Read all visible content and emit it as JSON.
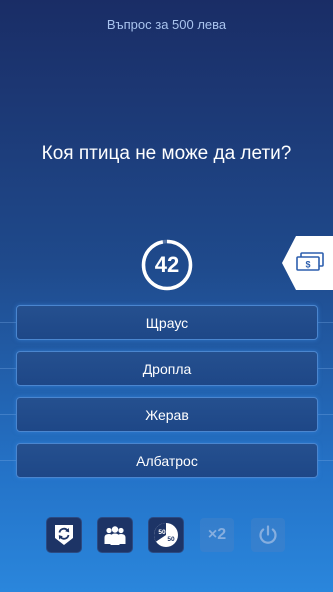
{
  "header": {
    "prize_label": "Въпрос за 500 лева"
  },
  "question": {
    "text": "Коя птица не може да лети?"
  },
  "timer": {
    "seconds": 42,
    "display": "42"
  },
  "answers": [
    {
      "label": "Щраус"
    },
    {
      "label": "Дропла"
    },
    {
      "label": "Жерав"
    },
    {
      "label": "Албатрос"
    }
  ],
  "lifelines": {
    "switch_question": {
      "icon": "switch-question-icon",
      "state": "available"
    },
    "ask_audience": {
      "icon": "audience-icon",
      "state": "available"
    },
    "fifty_fifty": {
      "icon": "fifty-fifty-icon",
      "label_a": "50",
      "label_b": "50",
      "state": "available"
    },
    "double_dip": {
      "icon": "double-dip-icon",
      "label": "×2",
      "state": "used"
    },
    "quit": {
      "icon": "power-icon",
      "state": "used"
    }
  },
  "colors": {
    "accent": "#4b86cf",
    "timer_ring": "#ffffff",
    "muted_icon": "#86aedf"
  }
}
